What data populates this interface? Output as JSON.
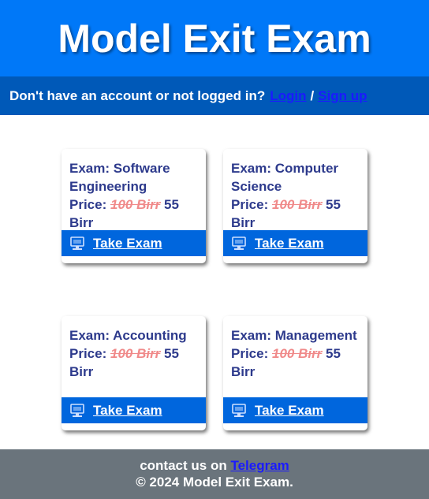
{
  "header": {
    "title": "Model Exit Exam"
  },
  "login_bar": {
    "prompt": "Don't have an account or not logged in?",
    "login_label": "Login",
    "separator": "/",
    "signup_label": "Sign up"
  },
  "exams": [
    {
      "title_prefix": "Exam:",
      "name": "Software Engineering",
      "price_label": "Price:",
      "old_price": "100 Birr",
      "new_price": "55",
      "currency": "Birr",
      "cta_label": "Take Exam"
    },
    {
      "title_prefix": "Exam:",
      "name": "Computer Science",
      "price_label": "Price:",
      "old_price": "100 Birr",
      "new_price": "55",
      "currency": "Birr",
      "cta_label": "Take Exam"
    },
    {
      "title_prefix": "Exam:",
      "name": "Accounting",
      "price_label": "Price:",
      "old_price": "100 Birr",
      "new_price": "55",
      "currency": "Birr",
      "cta_label": "Take Exam"
    },
    {
      "title_prefix": "Exam:",
      "name": "Management",
      "price_label": "Price:",
      "old_price": "100 Birr",
      "new_price": "55",
      "currency": "Birr",
      "cta_label": "Take Exam"
    }
  ],
  "footer": {
    "contact_text": "contact us on",
    "telegram_label": "Telegram",
    "copyright": "© 2024 Model Exit Exam."
  },
  "icons": {
    "cta_icon": "computer-monitor-icon"
  },
  "colors": {
    "header_bg": "#0078f8",
    "login_bar_bg": "#0059b8",
    "cta_bg": "#0066dd",
    "card_text": "#2d3a8c",
    "old_price": "#f08a8a",
    "footer_bg": "#6a747c",
    "link": "#1a1aff"
  }
}
